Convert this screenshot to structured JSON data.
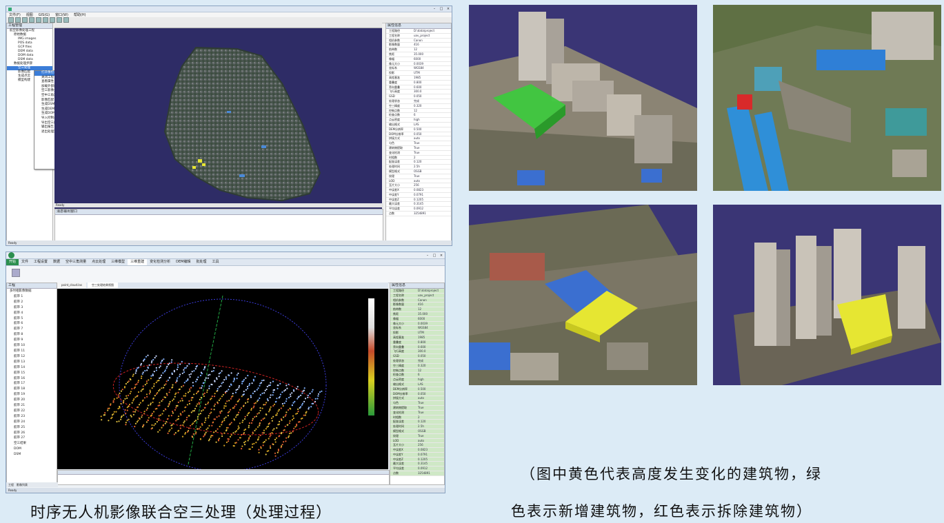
{
  "win1": {
    "menus": [
      "文件(F)",
      "视图",
      "GIS(G)",
      "窗口(W)",
      "帮助(H)"
    ],
    "project_panel_title": "工程管理",
    "tree": [
      "航空影像处理工程",
      "原始数据",
      "IMG images",
      "POS data",
      "GCP files",
      "DEM data",
      "DOM data",
      "DSM data",
      "数据处理步骤",
      "空三处理",
      "影像匹配",
      "生成点云",
      "模型构建"
    ],
    "context_menu": [
      "打开像控点工程",
      "关闭工程",
      "查看属性",
      "加载外部成果数据",
      "空三影像分析",
      "空中三角测量",
      "影像匹配",
      "生成DSM点云",
      "生成DEM数据",
      "生成DOM数据",
      "导入控制点",
      "导出空三成果",
      "输出报告",
      "退出处理流程"
    ],
    "viewport_status": "Ready",
    "log_panel_title": "消息输出窗口",
    "props_title": "属性信息",
    "props": [
      [
        "工程路径",
        "D:\\data\\project"
      ],
      [
        "工程名称",
        "uav_project"
      ],
      [
        "相机参数",
        "Canon"
      ],
      [
        "影像数量",
        "416"
      ],
      [
        "航带数",
        "12"
      ],
      [
        "焦距",
        "35.000"
      ],
      [
        "像幅",
        "6000"
      ],
      [
        "像元大小",
        "0.0039"
      ],
      [
        "坐标系",
        "WGS84"
      ],
      [
        "投影",
        "UTM"
      ],
      [
        "高程基准",
        "1985"
      ],
      [
        "重叠度",
        "0.800"
      ],
      [
        "旁向重叠",
        "0.600"
      ],
      [
        "飞行高度",
        "300.0"
      ],
      [
        "GSD",
        "0.050"
      ],
      [
        "处理状态",
        "完成"
      ],
      [
        "空三精度",
        "0.320"
      ],
      [
        "控制点数",
        "12"
      ],
      [
        "检查点数",
        "6"
      ],
      [
        "点云密度",
        "high"
      ],
      [
        "输出格式",
        "LAS"
      ],
      [
        "DEM分辨率",
        "0.500"
      ],
      [
        "DOM分辨率",
        "0.050"
      ],
      [
        "拼接方式",
        "auto"
      ],
      [
        "匀色",
        "True"
      ],
      [
        "建筑物提取",
        "True"
      ],
      [
        "变化检测",
        "True"
      ],
      [
        "时相数",
        "2"
      ],
      [
        "配准误差",
        "0.120"
      ],
      [
        "处理时间",
        "2.5h"
      ],
      [
        "模型格式",
        "OSGB"
      ],
      [
        "纹理",
        "True"
      ],
      [
        "LOD",
        "auto"
      ],
      [
        "瓦片大小",
        "256"
      ],
      [
        "中误差X",
        "0.0823"
      ],
      [
        "中误差Y",
        "0.0791"
      ],
      [
        "中误差Z",
        "0.1205"
      ],
      [
        "最大误差",
        "0.3145"
      ],
      [
        "平均误差",
        "0.0912"
      ],
      [
        "点数",
        "3254891"
      ]
    ],
    "status": "Ready"
  },
  "win2": {
    "tabs": [
      "开始",
      "文件",
      "工程设置",
      "数据",
      "空中三角测量",
      "点云处理",
      "三维模型",
      "三维重建",
      "变化检测分析",
      "DEM编辑",
      "批处理",
      "工具"
    ],
    "left_panel_title": "工程",
    "tree": [
      "多时相影像数据",
      "航带 1",
      "航带 2",
      "航带 3",
      "航带 4",
      "航带 5",
      "航带 6",
      "航带 7",
      "航带 8",
      "航带 9",
      "航带 10",
      "航带 11",
      "航带 12",
      "航带 13",
      "航带 14",
      "航带 15",
      "航带 16",
      "航带 17",
      "航带 18",
      "航带 19",
      "航带 20",
      "航带 21",
      "航带 22",
      "航带 23",
      "航带 24",
      "航带 25",
      "航带 26",
      "航带 27",
      "空三结果",
      "DOM",
      "DSM"
    ],
    "doc_tabs": [
      "point_cloud.las",
      "空三处理结果视图"
    ],
    "props_title": "属性信息",
    "bottom_tabs": [
      "工程",
      "影像列表"
    ],
    "status": "Ready"
  },
  "captions": {
    "left": "时序无人机影像联合空三处理（处理过程）",
    "right_line1": "（图中黄色代表高度发生变化的建筑物，绿",
    "right_line2": "色表示新增建筑物，红色表示拆除建筑物）"
  },
  "colors": {
    "changed_height": "#e6e632",
    "new_building": "#3ec83e",
    "removed_building": "#d82a2a",
    "viewport_bg": "#2e2c66"
  }
}
